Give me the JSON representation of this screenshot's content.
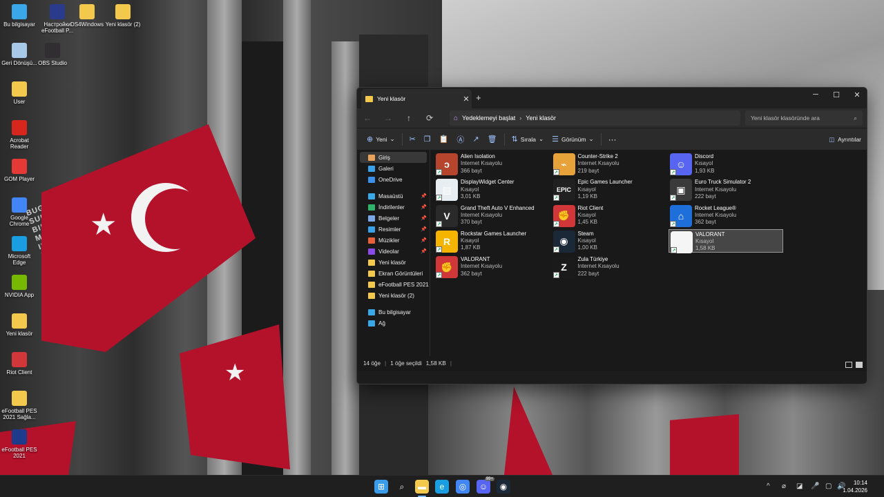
{
  "desktop": {
    "icons": [
      {
        "label": "Bu bilgisayar",
        "icon": "computer-icon",
        "color": "#3aa8e8"
      },
      {
        "label": "Настройки eFootball P...",
        "icon": "efootball-settings-icon",
        "color": "#2b3b8c"
      },
      {
        "label": "DS4Windows",
        "icon": "folder-icon",
        "color": "#f2c94c"
      },
      {
        "label": "Yeni klasör (2)",
        "icon": "folder-icon",
        "color": "#f2c94c"
      },
      {
        "label": "Geri Dönüşü...",
        "icon": "recycle-bin-icon",
        "color": "#a8c8e8"
      },
      {
        "label": "OBS Studio",
        "icon": "obs-icon",
        "color": "#302e31"
      },
      {
        "label": "User",
        "icon": "folder-icon",
        "color": "#f2c94c"
      },
      {
        "label": "Acrobat Reader",
        "icon": "acrobat-icon",
        "color": "#d7261e"
      },
      {
        "label": "GOM Player",
        "icon": "gom-player-icon",
        "color": "#e53935"
      },
      {
        "label": "Google Chrome",
        "icon": "chrome-icon",
        "color": "#4285f4"
      },
      {
        "label": "Microsoft Edge",
        "icon": "edge-icon",
        "color": "#1b9de2"
      },
      {
        "label": "NVIDIA App",
        "icon": "nvidia-icon",
        "color": "#76b900"
      },
      {
        "label": "Yeni klasör",
        "icon": "folder-icon",
        "color": "#f2c94c"
      },
      {
        "label": "Riot Client",
        "icon": "riot-icon",
        "color": "#d13639"
      },
      {
        "label": "eFootball PES 2021 Sağla...",
        "icon": "folder-icon",
        "color": "#f2c94c"
      },
      {
        "label": "eFootball PES 2021",
        "icon": "pes-icon",
        "color": "#1e3a8a"
      }
    ]
  },
  "explorer": {
    "tab_title": "Yeni klasör",
    "tab_close": "✕",
    "new_tab": "+",
    "window_controls": {
      "minimize": "─",
      "maximize": "☐",
      "close": "✕"
    },
    "nav": {
      "back": "←",
      "forward": "→",
      "up": "↑",
      "refresh": "⟳"
    },
    "breadcrumb": [
      "Yedeklemeyi başlat",
      "Yeni klasör"
    ],
    "search_placeholder": "Yeni klasör klasöründe ara",
    "toolbar": {
      "new_label": "Yeni",
      "sort_label": "Sırala",
      "view_label": "Görünüm",
      "more": "···",
      "details_label": "Ayrıntılar"
    },
    "sidebar": [
      {
        "label": "Giriş",
        "icon": "home-icon",
        "color": "#e8a25a",
        "selected": true,
        "pinned": false
      },
      {
        "label": "Galeri",
        "icon": "gallery-icon",
        "color": "#3aa0e8",
        "pinned": false
      },
      {
        "label": "OneDrive",
        "icon": "onedrive-icon",
        "color": "#3a8fe8",
        "pinned": false
      },
      {
        "label": "Masaüstü",
        "icon": "desktop-icon",
        "color": "#3aa8e8",
        "pinned": true
      },
      {
        "label": "İndirilenler",
        "icon": "downloads-icon",
        "color": "#2fb36b",
        "pinned": true
      },
      {
        "label": "Belgeler",
        "icon": "documents-icon",
        "color": "#7aa7e8",
        "pinned": true
      },
      {
        "label": "Resimler",
        "icon": "pictures-icon",
        "color": "#3aa0e8",
        "pinned": true
      },
      {
        "label": "Müzikler",
        "icon": "music-icon",
        "color": "#e8603a",
        "pinned": true
      },
      {
        "label": "Videolar",
        "icon": "videos-icon",
        "color": "#8a4ae8",
        "pinned": true
      },
      {
        "label": "Yeni klasör",
        "icon": "folder-icon",
        "color": "#f2c94c",
        "pinned": false
      },
      {
        "label": "Ekran Görüntüleri",
        "icon": "folder-icon",
        "color": "#f2c94c",
        "pinned": false
      },
      {
        "label": "eFootball PES 2021 Sa",
        "icon": "folder-icon",
        "color": "#f2c94c",
        "pinned": false
      },
      {
        "label": "Yeni klasör (2)",
        "icon": "folder-icon",
        "color": "#f2c94c",
        "pinned": false
      },
      {
        "label": "Bu bilgisayar",
        "icon": "computer-icon",
        "color": "#3aa8e8",
        "pinned": false
      },
      {
        "label": "Ağ",
        "icon": "network-icon",
        "color": "#3aa8e8",
        "pinned": false
      }
    ],
    "pin_glyph": "📌",
    "files": [
      {
        "name": "Alien Isolation",
        "type": "Internet Kısayolu",
        "size": "366 bayt",
        "icon": "alien-isolation-icon",
        "color": "#b5452d",
        "glyph": "ↄ"
      },
      {
        "name": "DisplayWidget Center",
        "type": "Kısayol",
        "size": "3,01 KB",
        "icon": "displaywidget-icon",
        "color": "#e8edf2",
        "glyph": "▤"
      },
      {
        "name": "Grand Theft Auto V Enhanced",
        "type": "Internet Kısayolu",
        "size": "370 bayt",
        "icon": "gta-v-icon",
        "color": "#2a2a2a",
        "glyph": "V"
      },
      {
        "name": "Rockstar Games Launcher",
        "type": "Kısayol",
        "size": "1,87 KB",
        "icon": "rockstar-icon",
        "color": "#f5b400",
        "glyph": "R"
      },
      {
        "name": "VALORANT",
        "type": "Internet Kısayolu",
        "size": "362 bayt",
        "icon": "riot-icon",
        "color": "#d13639",
        "glyph": "✊"
      },
      {
        "name": "Counter-Strike 2",
        "type": "Internet Kısayolu",
        "size": "219 bayt",
        "icon": "cs2-icon",
        "color": "#e8a23a",
        "glyph": "⌁"
      },
      {
        "name": "Epic Games Launcher",
        "type": "Kısayol",
        "size": "1,19 KB",
        "icon": "epic-games-icon",
        "color": "#202020",
        "glyph": "EPIC"
      },
      {
        "name": "Riot Client",
        "type": "Kısayol",
        "size": "1,45 KB",
        "icon": "riot-icon",
        "color": "#d13639",
        "glyph": "✊"
      },
      {
        "name": "Steam",
        "type": "Kısayol",
        "size": "1,00 KB",
        "icon": "steam-icon",
        "color": "#1b2838",
        "glyph": "◉"
      },
      {
        "name": "Zula Türkiye",
        "type": "Internet Kısayolu",
        "size": "222 bayt",
        "icon": "zula-icon",
        "color": "#1a1a1a",
        "glyph": "Z"
      },
      {
        "name": "Discord",
        "type": "Kısayol",
        "size": "1,93 KB",
        "icon": "discord-icon",
        "color": "#5865f2",
        "glyph": "☺"
      },
      {
        "name": "Euro Truck Simulator 2",
        "type": "Internet Kısayolu",
        "size": "222 bayt",
        "icon": "ets2-icon",
        "color": "#3a3a3a",
        "glyph": "▣"
      },
      {
        "name": "Rocket League®",
        "type": "Internet Kısayolu",
        "size": "362 bayt",
        "icon": "rocket-league-icon",
        "color": "#1e6fd9",
        "glyph": "⌂"
      },
      {
        "name": "VALORANT",
        "type": "Kısayol",
        "size": "1,58 KB",
        "icon": "blank-file-icon",
        "color": "#f5f5f5",
        "glyph": "",
        "selected": true
      }
    ],
    "status": {
      "count": "14 öğe",
      "selected": "1 öğe seçildi",
      "size": "1,58 KB"
    }
  },
  "taskbar": {
    "apps": [
      {
        "icon": "windows-start-icon",
        "color": "#3a9ce8",
        "glyph": "⊞"
      },
      {
        "icon": "search-icon",
        "color": "#1f1f1f",
        "glyph": "⌕"
      },
      {
        "icon": "file-explorer-icon",
        "color": "#f2c94c",
        "glyph": "▬"
      },
      {
        "icon": "edge-icon",
        "color": "#1b9de2",
        "glyph": "e"
      },
      {
        "icon": "chrome-icon",
        "color": "#4285f4",
        "glyph": "◎"
      },
      {
        "icon": "discord-icon",
        "color": "#5865f2",
        "glyph": "☺"
      },
      {
        "icon": "steam-icon",
        "color": "#1b2838",
        "glyph": "◉"
      }
    ],
    "discord_badge": "99+",
    "tray": [
      "^",
      "⌀",
      "◪",
      "🎤",
      "▢",
      "🔊"
    ],
    "time": "10:14",
    "date": "1.04.2026"
  }
}
